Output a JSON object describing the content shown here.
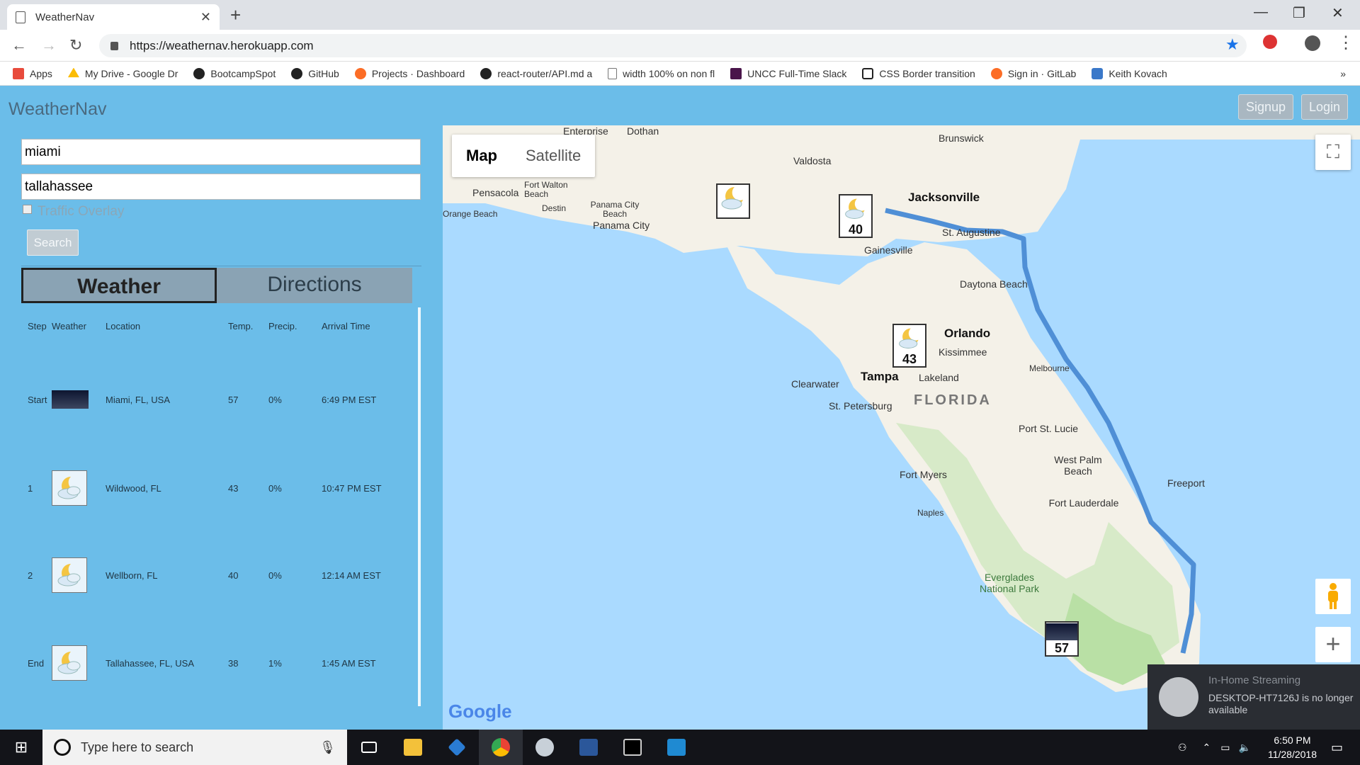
{
  "browser": {
    "tab_title": "WeatherNav",
    "url": "https://weathernav.herokuapp.com",
    "bookmarks": [
      {
        "label": "Apps",
        "icon": "apps-grid-icon",
        "color": "#e84b3c"
      },
      {
        "label": "My Drive - Google Dr",
        "icon": "google-drive-icon",
        "color": "#fbbc04"
      },
      {
        "label": "BootcampSpot",
        "icon": "github-icon",
        "color": "#222222"
      },
      {
        "label": "GitHub",
        "icon": "github-icon",
        "color": "#222222"
      },
      {
        "label": "Projects · Dashboard",
        "icon": "gitlab-icon",
        "color": "#fc6d26"
      },
      {
        "label": "react-router/API.md a",
        "icon": "github-icon",
        "color": "#222222"
      },
      {
        "label": "width 100% on non fl",
        "icon": "page-icon",
        "color": "#999999"
      },
      {
        "label": "UNCC Full-Time Slack",
        "icon": "slack-icon",
        "color": "#4a154b"
      },
      {
        "label": "CSS Border transition",
        "icon": "codepen-icon",
        "color": "#222222"
      },
      {
        "label": "Sign in · GitLab",
        "icon": "gitlab-icon",
        "color": "#fc6d26"
      },
      {
        "label": "Keith Kovach",
        "icon": "profile-icon",
        "color": "#3a78c9"
      }
    ]
  },
  "app": {
    "brand": "WeatherNav",
    "signup_label": "Signup",
    "login_label": "Login",
    "origin_value": "miami",
    "destination_value": "tallahassee",
    "traffic_label": "Traffic Overlay",
    "search_label": "Search",
    "tab_weather": "Weather",
    "tab_directions": "Directions",
    "table": {
      "headers": [
        "Step",
        "Weather",
        "Location",
        "Temp.",
        "Precip.",
        "Arrival Time"
      ],
      "rows": [
        {
          "step": "Start",
          "icon": "night-sky-icon",
          "location": "Miami, FL, USA",
          "temp": "57",
          "precip": "0%",
          "arrival": "6:49 PM EST"
        },
        {
          "step": "1",
          "icon": "partly-cloudy-night-icon",
          "location": "Wildwood, FL",
          "temp": "43",
          "precip": "0%",
          "arrival": "10:47 PM EST"
        },
        {
          "step": "2",
          "icon": "partly-cloudy-night-icon",
          "location": "Wellborn, FL",
          "temp": "40",
          "precip": "0%",
          "arrival": "12:14 AM EST"
        },
        {
          "step": "End",
          "icon": "partly-cloudy-night-icon",
          "location": "Tallahassee, FL, USA",
          "temp": "38",
          "precip": "1%",
          "arrival": "1:45 AM EST"
        }
      ]
    }
  },
  "map": {
    "type_map": "Map",
    "type_satellite": "Satellite",
    "logo": "Google",
    "labels": [
      "Enterprise",
      "Dothan",
      "Brunswick",
      "Valdosta",
      "Jacksonville",
      "Pensacola",
      "Fort Walton Beach",
      "Destin",
      "Panama City Beach",
      "Panama City",
      "Orange Beach",
      "St. Augustine",
      "Gainesville",
      "Daytona Beach",
      "Orlando",
      "Kissimmee",
      "Tampa",
      "Lakeland",
      "Clearwater",
      "St. Petersburg",
      "FLORIDA",
      "Melbourne",
      "Port St. Lucie",
      "West Palm Beach",
      "Fort Myers",
      "Fort Lauderdale",
      "Naples",
      "Freeport",
      "Everglades National Park"
    ],
    "markers": [
      "40",
      "43",
      "57"
    ],
    "land_color": "#f4f1e8",
    "water_color": "#aadaff",
    "route_color": "#4f8fd6"
  },
  "notification": {
    "title": "In-Home Streaming",
    "body": "DESKTOP-HT7126J is no longer available"
  },
  "taskbar": {
    "search_placeholder": "Type here to search",
    "time": "6:50 PM",
    "date": "11/28/2018"
  }
}
